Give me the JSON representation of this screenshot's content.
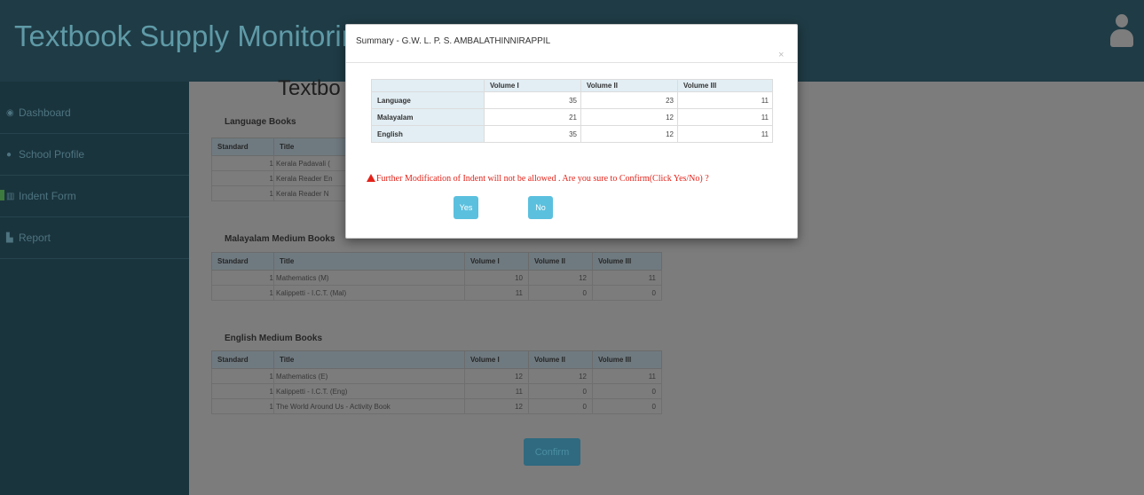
{
  "header": {
    "app_title": "Textbook Supply Monitoring",
    "user_icon": "user-icon"
  },
  "sidebar": {
    "items": [
      {
        "label": "Dashboard",
        "icon": "dashboard-icon"
      },
      {
        "label": "School Profile",
        "icon": "user-icon"
      },
      {
        "label": "Indent Form",
        "icon": "bank-icon"
      },
      {
        "label": "Report",
        "icon": "bar-chart-icon"
      }
    ]
  },
  "main": {
    "heading": "Textbo",
    "columns": {
      "standard": "Standard",
      "title": "Title",
      "vol1": "Volume I",
      "vol2": "Volume II",
      "vol3": "Volume III"
    },
    "language": {
      "title": "Language Books",
      "rows": [
        {
          "std": "1",
          "title": "Kerala Padavali ("
        },
        {
          "std": "1",
          "title": "Kerala Reader En"
        },
        {
          "std": "1",
          "title": "Kerala Reader N"
        }
      ]
    },
    "malayalam": {
      "title": "Malayalam Medium Books",
      "rows": [
        {
          "std": "1",
          "title": "Mathematics (M)",
          "v1": "10",
          "v2": "12",
          "v3": "11"
        },
        {
          "std": "1",
          "title": "Kalippetti - I.C.T. (Mal)",
          "v1": "11",
          "v2": "0",
          "v3": "0"
        }
      ]
    },
    "english": {
      "title": "English Medium Books",
      "rows": [
        {
          "std": "1",
          "title": "Mathematics (E)",
          "v1": "12",
          "v2": "12",
          "v3": "11"
        },
        {
          "std": "1",
          "title": "Kalippetti - I.C.T. (Eng)",
          "v1": "11",
          "v2": "0",
          "v3": "0"
        },
        {
          "std": "1",
          "title": "The World Around Us - Activity Book",
          "v1": "12",
          "v2": "0",
          "v3": "0"
        }
      ]
    },
    "confirm_label": "Confirm"
  },
  "modal": {
    "title": "Summary - G.W. L. P. S. AMBALATHINNIRAPPIL",
    "close": "×",
    "columns": [
      "",
      "Volume I",
      "Volume II",
      "Volume III"
    ],
    "rows": [
      {
        "label": "Language",
        "v1": "35",
        "v2": "23",
        "v3": "11"
      },
      {
        "label": "Malayalam",
        "v1": "21",
        "v2": "12",
        "v3": "11"
      },
      {
        "label": "English",
        "v1": "35",
        "v2": "12",
        "v3": "11"
      }
    ],
    "warning": "Further Modification of Indent will not be allowed . Are you sure to Confirm(Click Yes/No) ?",
    "yes_label": "Yes",
    "no_label": "No"
  }
}
